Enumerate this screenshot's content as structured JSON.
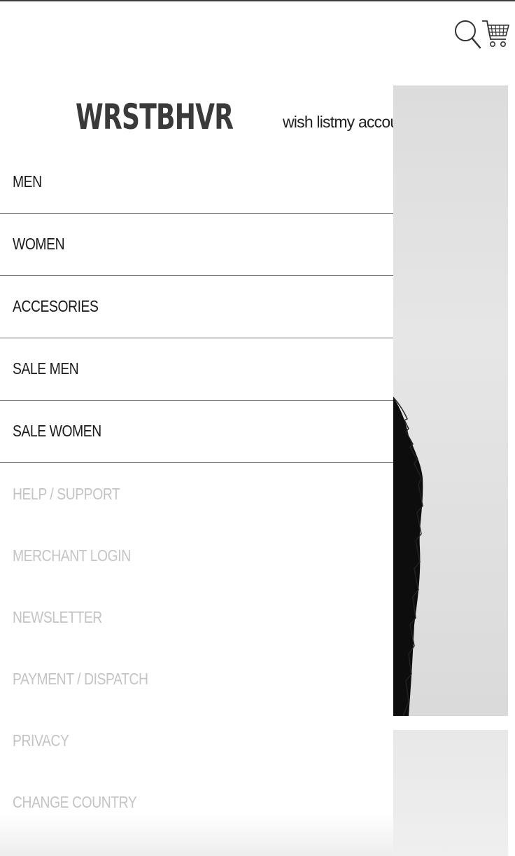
{
  "header": {
    "search_icon": "search-icon",
    "cart_icon": "cart-icon"
  },
  "brand": {
    "logo_text": "WRSTBHVR"
  },
  "account": {
    "wish_list": "wish list",
    "my_account": "my account"
  },
  "menu": {
    "items": [
      {
        "label": "MEN"
      },
      {
        "label": "WOMEN"
      },
      {
        "label": "ACCESORIES"
      },
      {
        "label": "SALE MEN"
      },
      {
        "label": "SALE WOMEN"
      }
    ]
  },
  "secondary_menu": {
    "items": [
      {
        "label": "HELP / SUPPORT"
      },
      {
        "label": "MERCHANT LOGIN"
      },
      {
        "label": "NEWSLETTER"
      },
      {
        "label": "PAYMENT / DISPATCH"
      },
      {
        "label": "PRIVACY"
      },
      {
        "label": "CHANGE COUNTRY"
      }
    ]
  },
  "colors": {
    "primary_text": "#1a1a1a",
    "muted_text": "#c4c4c4",
    "divider": "#6c6c6c",
    "logo": "#3a3a3a"
  }
}
